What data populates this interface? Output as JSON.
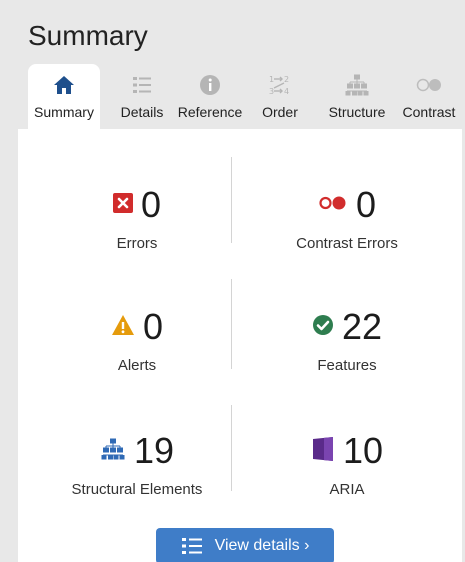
{
  "panel": {
    "title": "Summary"
  },
  "tabs": [
    {
      "label": "Summary",
      "icon": "home-icon",
      "active": true
    },
    {
      "label": "Details",
      "icon": "list-icon",
      "active": false
    },
    {
      "label": "Reference",
      "icon": "info-icon",
      "active": false
    },
    {
      "label": "Order",
      "icon": "order-icon",
      "active": false
    },
    {
      "label": "Structure",
      "icon": "structure-icon",
      "active": false
    },
    {
      "label": "Contrast",
      "icon": "contrast-icon",
      "active": false
    }
  ],
  "stats": {
    "errors": {
      "count": "0",
      "label": "Errors",
      "icon": "error-icon",
      "color": "#d12c2c"
    },
    "contrast_errors": {
      "count": "0",
      "label": "Contrast Errors",
      "icon": "contrast-error-icon",
      "color": "#d12c2c"
    },
    "alerts": {
      "count": "0",
      "label": "Alerts",
      "icon": "alert-icon",
      "color": "#e59b0c"
    },
    "features": {
      "count": "22",
      "label": "Features",
      "icon": "feature-check-icon",
      "color": "#2e7d4f"
    },
    "structural": {
      "count": "19",
      "label": "Structural Elements",
      "icon": "structure-icon",
      "color": "#2f6ab5"
    },
    "aria": {
      "count": "10",
      "label": "ARIA",
      "icon": "aria-icon",
      "color": "#5a2a8a"
    }
  },
  "view_details": {
    "label": "View details ›"
  },
  "colors": {
    "accent": "#3f7dc8",
    "panel_bg": "#e8e8e8",
    "content_bg": "#ffffff"
  }
}
